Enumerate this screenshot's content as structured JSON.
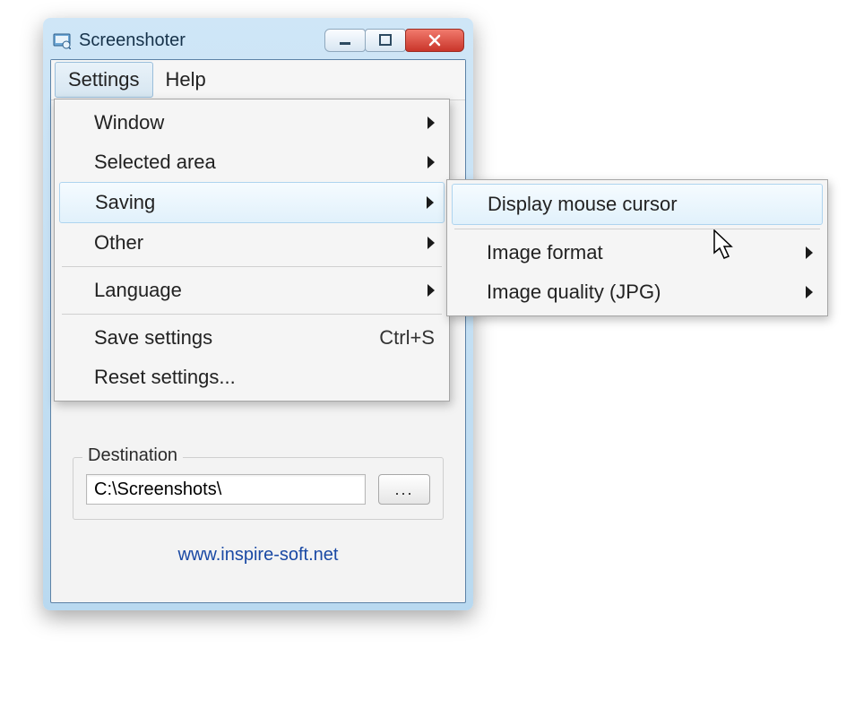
{
  "window": {
    "title": "Screenshoter"
  },
  "menubar": {
    "settings": "Settings",
    "help": "Help"
  },
  "settings_menu": {
    "window": "Window",
    "selected_area": "Selected area",
    "saving": "Saving",
    "other": "Other",
    "language": "Language",
    "save_settings": "Save settings",
    "save_settings_accel": "Ctrl+S",
    "reset_settings": "Reset settings..."
  },
  "saving_submenu": {
    "display_cursor": "Display mouse cursor",
    "image_format": "Image format",
    "image_quality": "Image quality (JPG)"
  },
  "destination": {
    "legend": "Destination",
    "path": "C:\\Screenshots\\",
    "browse": "..."
  },
  "footer": {
    "link": "www.inspire-soft.net"
  }
}
